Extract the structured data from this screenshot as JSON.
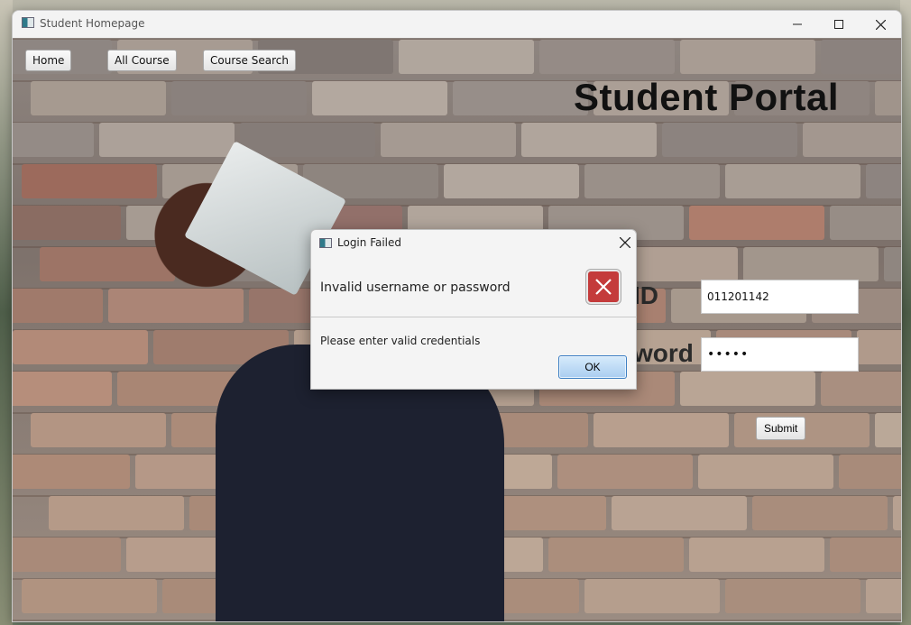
{
  "window": {
    "title": "Student Homepage",
    "controls": {
      "minimize": "minimize-icon",
      "maximize": "maximize-icon",
      "close": "close-icon"
    }
  },
  "nav": {
    "home_label": "Home",
    "all_course_label": "All Course",
    "course_search_label": "Course Search"
  },
  "page": {
    "title": "Student Portal"
  },
  "form": {
    "id_label_visible": "ID",
    "password_label_visible": "word",
    "id_value": "011201142",
    "password_value": "•••••",
    "submit_label": "Submit"
  },
  "dialog": {
    "title": "Login Failed",
    "header": "Invalid username or password",
    "content": "Please enter valid credentials",
    "ok_label": "OK",
    "icon": "error-x-icon",
    "error_color": "#c43b3b"
  }
}
